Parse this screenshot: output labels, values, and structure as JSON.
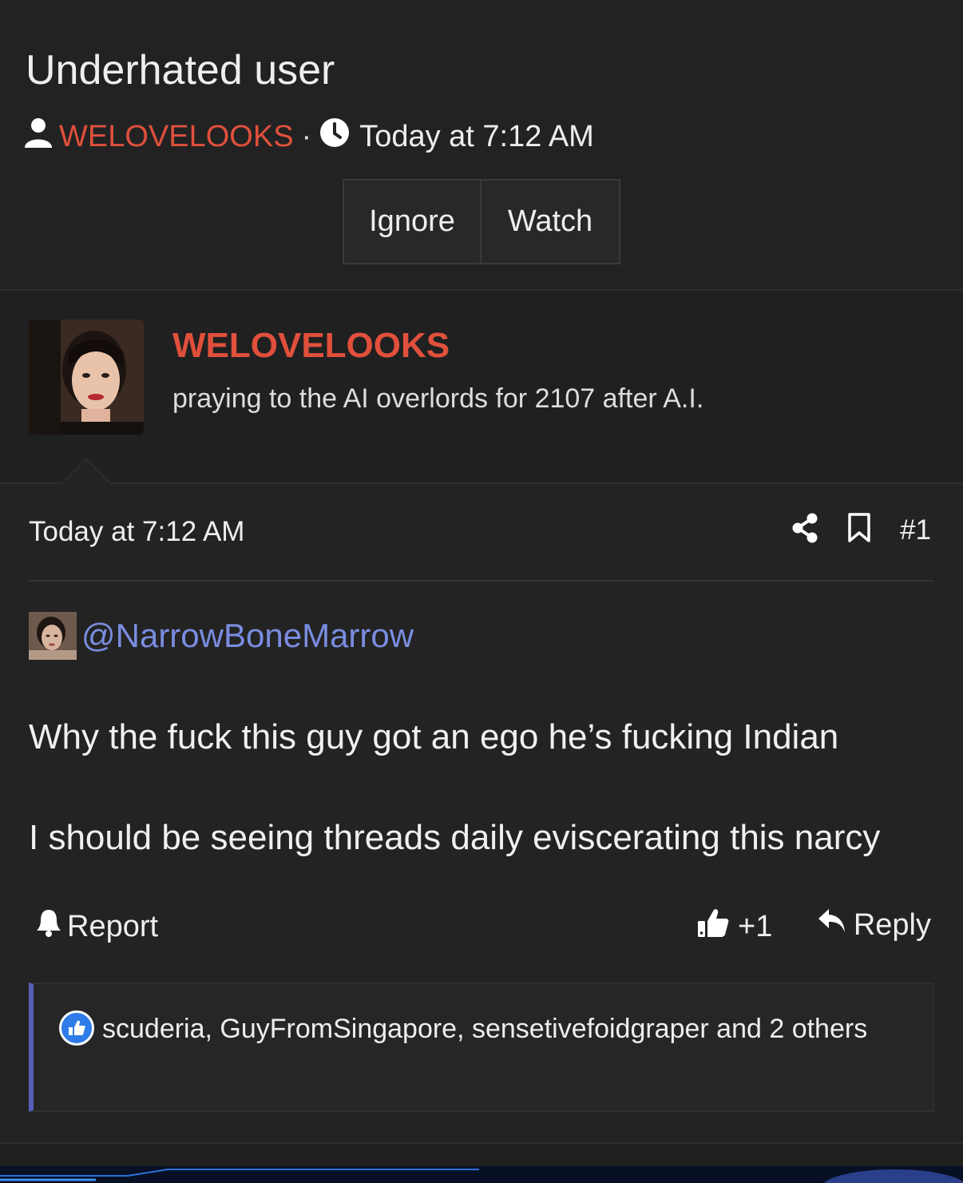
{
  "thread": {
    "title": "Underhated user",
    "author": "WELOVELOOKS",
    "separator": "·",
    "time": "Today at 7:12 AM",
    "buttons": {
      "ignore": "Ignore",
      "watch": "Watch"
    }
  },
  "user_card": {
    "name": "WELOVELOOKS",
    "title": "praying to the AI overlords for 2107 after A.I."
  },
  "post": {
    "time": "Today at 7:12 AM",
    "number": "#1",
    "mention": "@NarrowBoneMarrow",
    "body_line1": "Why the fuck this guy got an ego he’s fucking Indian",
    "body_line2": "I should be seeing threads daily eviscerating this narcy",
    "actions": {
      "report": "Report",
      "like_count": "+1",
      "reply": "Reply"
    },
    "reactions": {
      "text": "scuderia, GuyFromSingapore, sensetivefoidgraper and 2 others"
    }
  },
  "colors": {
    "accent": "#e0503c",
    "mention": "#7a8de0",
    "reaction_border": "#5560b8",
    "like_badge": "#2f7be8"
  },
  "icons": [
    "user-icon",
    "clock-icon",
    "share-icon",
    "bookmark-icon",
    "bell-icon",
    "thumbs-up-icon",
    "reply-icon",
    "like-reaction-icon"
  ]
}
